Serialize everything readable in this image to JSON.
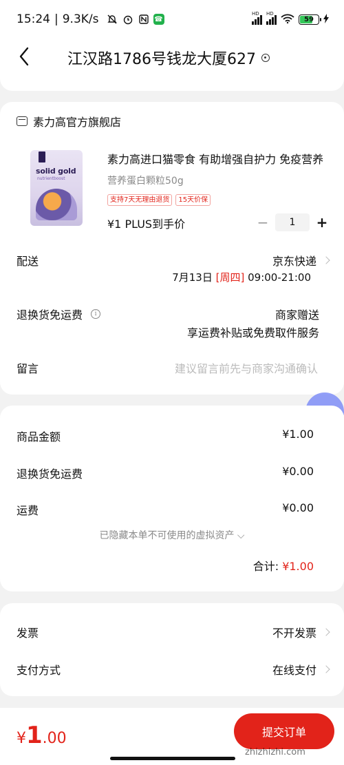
{
  "status": {
    "time": "15:24",
    "net_speed": "9.3K/s",
    "net1_label": "HD",
    "net2_label": "HD",
    "battery": "59",
    "icons": [
      "mute-icon",
      "alarm-icon",
      "nfc-icon",
      "wechat-icon",
      "wifi-icon",
      "signal-icon"
    ]
  },
  "header": {
    "address": "江汉路1786号钱龙大厦627"
  },
  "shop": {
    "name": "素力高官方旗舰店"
  },
  "product": {
    "title": "素力高进口猫零食 有助增强自护力 免疫营养",
    "spec": "营养蛋白颗粒50g",
    "tags": [
      "支持7天无理由退货",
      "15天价保"
    ],
    "price": "¥1 PLUS到手价",
    "quantity": "1",
    "image_brand": "solid gold",
    "image_sub": "nutrientboost"
  },
  "delivery": {
    "label": "配送",
    "carrier": "京东快递",
    "date": "7月13日",
    "weekday": "[周四]",
    "time": "09:00-21:00"
  },
  "return_ship": {
    "label": "退换货免运费",
    "value": "商家赠送",
    "desc": "享运费补贴或免费取件服务"
  },
  "memo": {
    "label": "留言",
    "placeholder": "建议留言前先与商家沟通确认"
  },
  "amounts": [
    {
      "label": "商品金额",
      "value": "¥1.00"
    },
    {
      "label": "退换货免运费",
      "value": "¥0.00"
    },
    {
      "label": "运费",
      "value": "¥0.00"
    }
  ],
  "hidden_note": "已隐藏本单不可使用的虚拟资产 ⌵",
  "total": {
    "label": "合计:",
    "value": "¥1.00"
  },
  "invoice": {
    "label": "发票",
    "value": "不开发票"
  },
  "payment": {
    "label": "支付方式",
    "value": "在线支付"
  },
  "bottom": {
    "yen": "¥",
    "int": "1",
    "dec": ".00",
    "submit": "提交订单"
  },
  "watermark": "zhizhizhi.com",
  "colors": {
    "accent": "#e2231a",
    "float": "#7f8ff7"
  }
}
